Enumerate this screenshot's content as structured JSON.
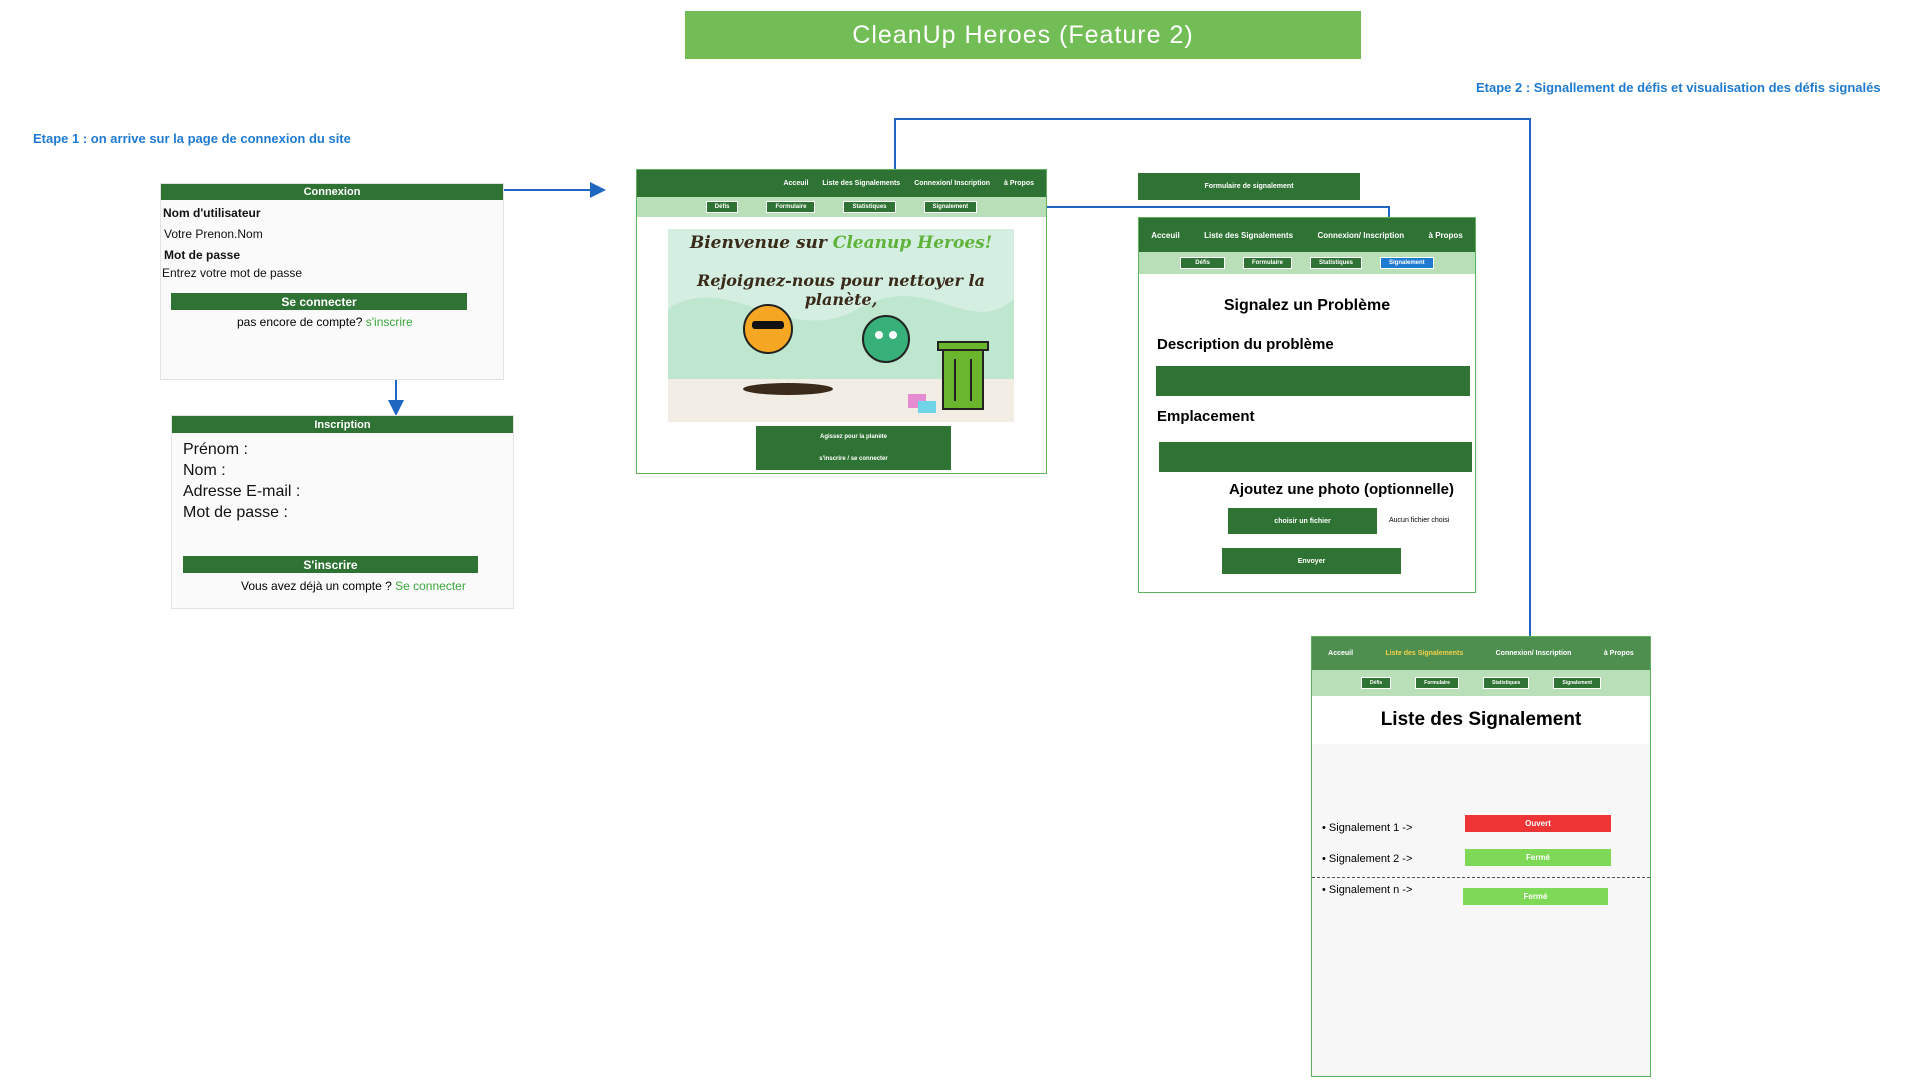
{
  "title": "CleanUp Heroes (Feature 2)",
  "step1": "Etape 1 : on arrive sur la page de connexion du site",
  "step2": "Etape 2 : Signallement de défis et visualisation des défis signalés",
  "login": {
    "header": "Connexion",
    "username_label": "Nom d'utilisateur",
    "username_placeholder": "Votre Prenon.Nom",
    "password_label": "Mot de passe",
    "password_placeholder": "Entrez votre mot de passe",
    "submit": "Se connecter",
    "no_account": "pas encore de compte?",
    "signup_link": "s'inscrire"
  },
  "signup": {
    "header": "Inscription",
    "fields": [
      "Prénom :",
      "Nom :",
      "Adresse E-mail :",
      "Mot de passe :"
    ],
    "submit": "S'inscrire",
    "have_account": "Vous avez déjà un compte ?",
    "login_link": "Se connecter"
  },
  "home": {
    "nav": [
      "Acceuil",
      "Liste des Signalements",
      "Connexion/ Inscription",
      "à Propos"
    ],
    "subnav": [
      "Défis",
      "Formulaire",
      "Statistiques",
      "Signalement"
    ],
    "banner_line1_a": "Bienvenue sur",
    "banner_line1_b": "Cleanup Heroes!",
    "banner_line2": "Rejoignez-nous pour nettoyer la planète,",
    "cta_line1": "Agissez pour la planète",
    "cta_line2": "s'inscrire / se connecter"
  },
  "report_form": {
    "caption": "Formulaire de signalement",
    "nav": [
      "Acceuil",
      "Liste des Signalements",
      "Connexion/ Inscription",
      "à Propos"
    ],
    "subnav": [
      "Défis",
      "Formulaire",
      "Statistiques",
      "Signalement"
    ],
    "heading": "Signalez un Problème",
    "description_label": "Description du problème",
    "location_label": "Emplacement",
    "photo_label": "Ajoutez une photo (optionnelle)",
    "choose_file": "choisir un fichier",
    "no_file": "Aucun fichier choisi",
    "send": "Envoyer"
  },
  "report_list": {
    "nav": [
      "Acceuil",
      "Liste des Signalements",
      "Connexion/ Inscription",
      "à Propos"
    ],
    "subnav": [
      "Défis",
      "Formulaire",
      "Statistiques",
      "Signalement"
    ],
    "heading": "Liste des Signalement",
    "items": [
      {
        "label": "• Signalement 1 ->",
        "status": "Ouvert",
        "color": "#ee3434"
      },
      {
        "label": "• Signalement 2 ->",
        "status": "Fermé",
        "color": "#7ed957"
      },
      {
        "label": "• Signalement n ->",
        "status": "Fermé",
        "color": "#7ed957"
      }
    ]
  },
  "colors": {
    "primary": "#2f7334",
    "light": "#b9dfb9",
    "accent": "#72bd55",
    "link": "#1f7bd1"
  }
}
